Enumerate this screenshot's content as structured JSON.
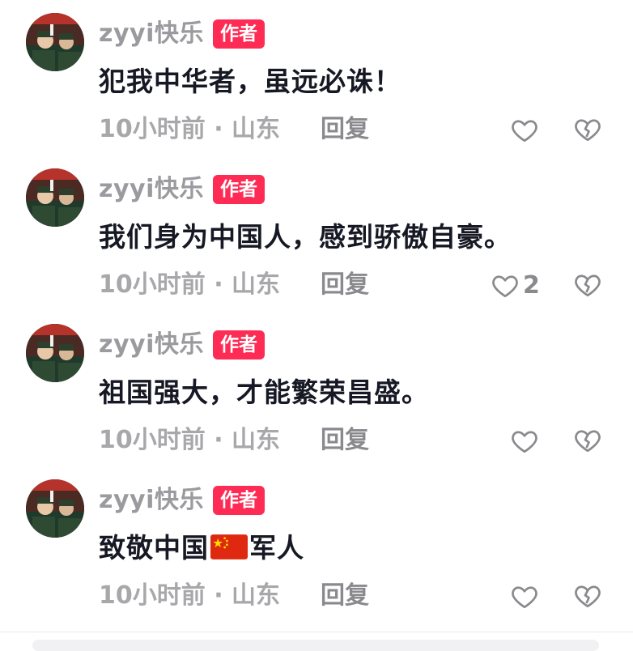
{
  "comments": [
    {
      "username": "zyyi快乐",
      "badge": "作者",
      "content": "犯我中华者，虽远必诛！",
      "time_location": "10小时前 · 山东",
      "reply_label": "回复",
      "like_count": ""
    },
    {
      "username": "zyyi快乐",
      "badge": "作者",
      "content": "我们身为中国人，感到骄傲自豪。",
      "time_location": "10小时前 · 山东",
      "reply_label": "回复",
      "like_count": "2"
    },
    {
      "username": "zyyi快乐",
      "badge": "作者",
      "content": "祖国强大，才能繁荣昌盛。",
      "time_location": "10小时前 · 山东",
      "reply_label": "回复",
      "like_count": ""
    },
    {
      "username": "zyyi快乐",
      "badge": "作者",
      "content_before_flag": "致敬中国",
      "content_after_flag": "军人",
      "time_location": "10小时前 · 山东",
      "reply_label": "回复",
      "like_count": ""
    }
  ],
  "icons": {
    "like": "heart-outline-icon",
    "dislike": "broken-heart-icon",
    "flag": "china-flag-emoji"
  },
  "colors": {
    "badge_bg": "#fe2c55",
    "text_primary": "#161823",
    "text_secondary": "#a8a8ab"
  }
}
